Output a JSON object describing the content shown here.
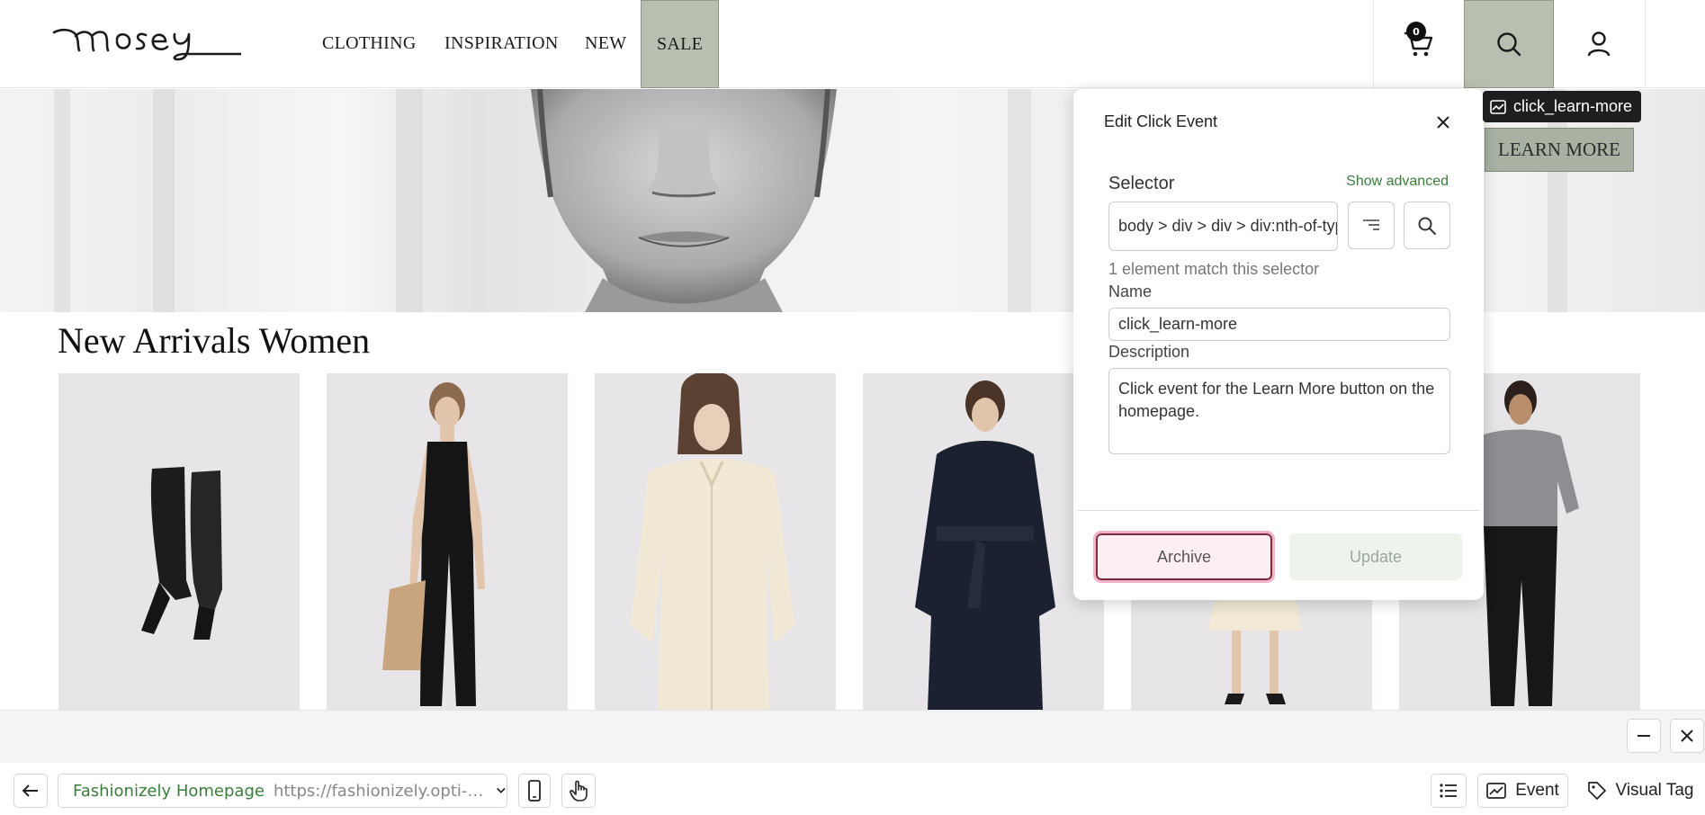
{
  "site": {
    "logo_text": "mosey",
    "nav": [
      "CLOTHING",
      "INSPIRATION",
      "NEW",
      "SALE"
    ],
    "cart_count": "0",
    "hero_button": "LEARN MORE",
    "section_title": "New Arrivals Women",
    "products": [
      {
        "name": "black-knee-boots"
      },
      {
        "name": "black-tank-jumpsuit"
      },
      {
        "name": "cream-silk-shirt"
      },
      {
        "name": "navy-belted-coat"
      },
      {
        "name": "cream-pleated-skirt"
      },
      {
        "name": "grey-top-black-trousers"
      }
    ]
  },
  "tooltip": {
    "icon": "event-icon",
    "label": "click_learn-more"
  },
  "panel": {
    "title": "Edit Click Event",
    "selector_label": "Selector",
    "show_advanced": "Show advanced",
    "selector_value": "body > div > div > div:nth-of-type",
    "match_text": "1 element match this selector",
    "name_label": "Name",
    "name_value": "click_learn-more",
    "description_label": "Description",
    "description_value": "Click event for the Learn More button on the homepage.",
    "archive_label": "Archive",
    "update_label": "Update"
  },
  "toolbar": {
    "page_name": "Fashionizely Homepage",
    "page_url": "https://fashionizely.opti-demo...",
    "event_label": "Event",
    "visual_tag_label": "Visual Tag"
  },
  "colors": {
    "accent_green": "#3a7d3a",
    "sale_bg": "#b8bfb1",
    "archive_outline": "#f2b3c8"
  }
}
